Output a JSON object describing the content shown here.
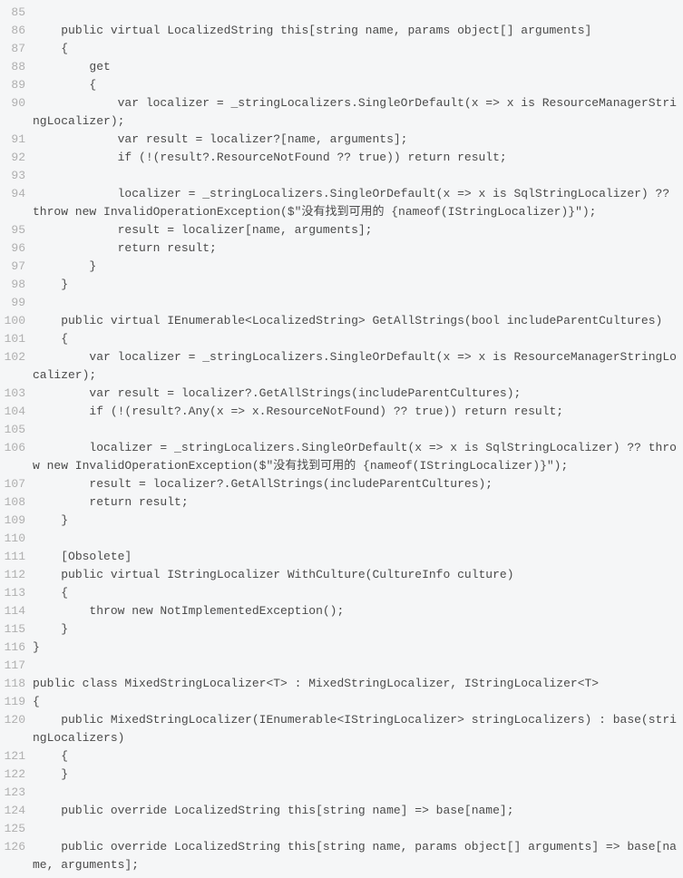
{
  "lines": [
    {
      "num": "85",
      "code": ""
    },
    {
      "num": "86",
      "code": "    public virtual LocalizedString this[string name, params object[] arguments]"
    },
    {
      "num": "87",
      "code": "    {"
    },
    {
      "num": "88",
      "code": "        get"
    },
    {
      "num": "89",
      "code": "        {"
    },
    {
      "num": "90",
      "code": "            var localizer = _stringLocalizers.SingleOrDefault(x => x is ResourceManagerStringLocalizer);"
    },
    {
      "num": "91",
      "code": "            var result = localizer?[name, arguments];"
    },
    {
      "num": "92",
      "code": "            if (!(result?.ResourceNotFound ?? true)) return result;"
    },
    {
      "num": "93",
      "code": ""
    },
    {
      "num": "94",
      "code": "            localizer = _stringLocalizers.SingleOrDefault(x => x is SqlStringLocalizer) ?? throw new InvalidOperationException($\"没有找到可用的 {nameof(IStringLocalizer)}\");"
    },
    {
      "num": "95",
      "code": "            result = localizer[name, arguments];"
    },
    {
      "num": "96",
      "code": "            return result;"
    },
    {
      "num": "97",
      "code": "        }"
    },
    {
      "num": "98",
      "code": "    }"
    },
    {
      "num": "99",
      "code": ""
    },
    {
      "num": "100",
      "code": "    public virtual IEnumerable<LocalizedString> GetAllStrings(bool includeParentCultures)"
    },
    {
      "num": "101",
      "code": "    {"
    },
    {
      "num": "102",
      "code": "        var localizer = _stringLocalizers.SingleOrDefault(x => x is ResourceManagerStringLocalizer);"
    },
    {
      "num": "103",
      "code": "        var result = localizer?.GetAllStrings(includeParentCultures);"
    },
    {
      "num": "104",
      "code": "        if (!(result?.Any(x => x.ResourceNotFound) ?? true)) return result;"
    },
    {
      "num": "105",
      "code": ""
    },
    {
      "num": "106",
      "code": "        localizer = _stringLocalizers.SingleOrDefault(x => x is SqlStringLocalizer) ?? throw new InvalidOperationException($\"没有找到可用的 {nameof(IStringLocalizer)}\");"
    },
    {
      "num": "107",
      "code": "        result = localizer?.GetAllStrings(includeParentCultures);"
    },
    {
      "num": "108",
      "code": "        return result;"
    },
    {
      "num": "109",
      "code": "    }"
    },
    {
      "num": "110",
      "code": ""
    },
    {
      "num": "111",
      "code": "    [Obsolete]"
    },
    {
      "num": "112",
      "code": "    public virtual IStringLocalizer WithCulture(CultureInfo culture)"
    },
    {
      "num": "113",
      "code": "    {"
    },
    {
      "num": "114",
      "code": "        throw new NotImplementedException();"
    },
    {
      "num": "115",
      "code": "    }"
    },
    {
      "num": "116",
      "code": "}"
    },
    {
      "num": "117",
      "code": ""
    },
    {
      "num": "118",
      "code": "public class MixedStringLocalizer<T> : MixedStringLocalizer, IStringLocalizer<T>"
    },
    {
      "num": "119",
      "code": "{"
    },
    {
      "num": "120",
      "code": "    public MixedStringLocalizer(IEnumerable<IStringLocalizer> stringLocalizers) : base(stringLocalizers)"
    },
    {
      "num": "121",
      "code": "    {"
    },
    {
      "num": "122",
      "code": "    }"
    },
    {
      "num": "123",
      "code": ""
    },
    {
      "num": "124",
      "code": "    public override LocalizedString this[string name] => base[name];"
    },
    {
      "num": "125",
      "code": ""
    },
    {
      "num": "126",
      "code": "    public override LocalizedString this[string name, params object[] arguments] => base[name, arguments];"
    }
  ]
}
